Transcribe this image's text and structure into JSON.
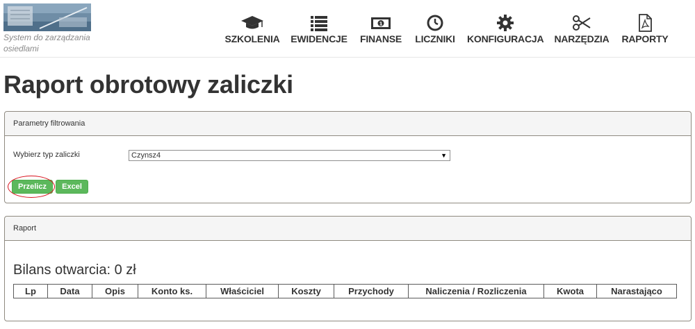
{
  "header": {
    "logo_text": "System do zarządzania osiedlami",
    "nav": [
      {
        "label": "SZKOLENIA",
        "icon": "graduation-cap-icon"
      },
      {
        "label": "EWIDENCJE",
        "icon": "list-icon"
      },
      {
        "label": "FINANSE",
        "icon": "money-icon"
      },
      {
        "label": "LICZNIKI",
        "icon": "clock-icon"
      },
      {
        "label": "KONFIGURACJA",
        "icon": "gear-icon"
      },
      {
        "label": "NARZĘDZIA",
        "icon": "scissors-icon"
      },
      {
        "label": "RAPORTY",
        "icon": "pdf-file-icon"
      }
    ]
  },
  "page": {
    "title": "Raport obrotowy zaliczki"
  },
  "filter": {
    "heading": "Parametry filtrowania",
    "type_label": "Wybierz typ zaliczki",
    "selected_type": "Czynsz4",
    "recalc_button": "Przelicz",
    "excel_button": "Excel"
  },
  "report": {
    "heading": "Raport",
    "opening_balance": "Bilans otwarcia: 0 zł",
    "columns": [
      "Lp",
      "Data",
      "Opis",
      "Konto ks.",
      "Właściciel",
      "Koszty",
      "Przychody",
      "Naliczenia / Rozliczenia",
      "Kwota",
      "Narastająco"
    ]
  },
  "colors": {
    "button_green": "#5cb85c",
    "highlight_red": "#d9141f",
    "panel_border": "#8f8a80"
  }
}
